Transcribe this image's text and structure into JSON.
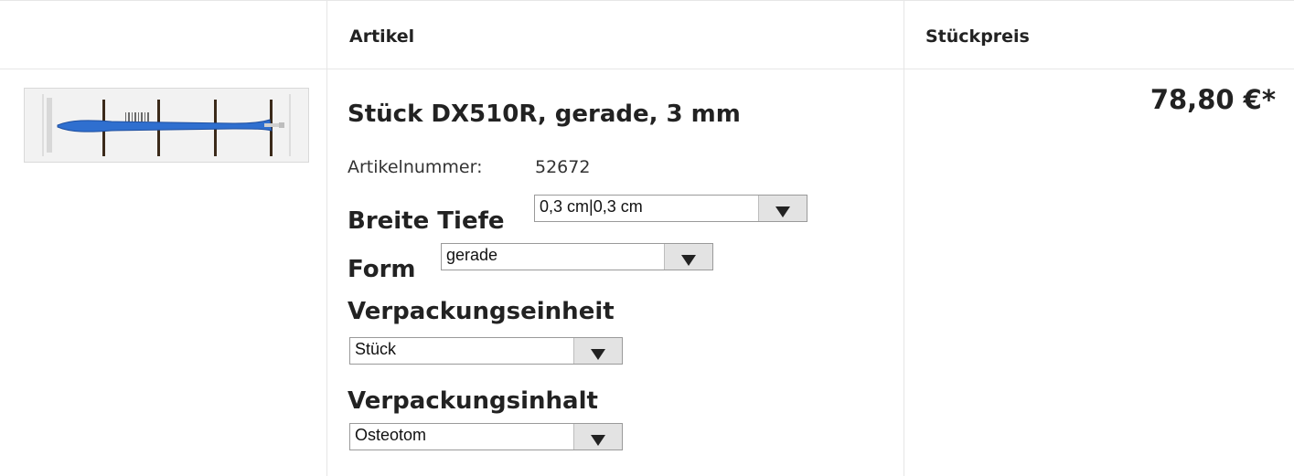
{
  "table": {
    "headers": {
      "article": "Artikel",
      "unit_price": "Stückpreis"
    }
  },
  "product": {
    "title": "Stück DX510R, gerade, 3 mm",
    "article_number_label": "Artikelnummer:",
    "article_number": "52672",
    "price": "78,80 €*",
    "image_icon": "blue-osteotome-in-sterile-package",
    "options": [
      {
        "label": "Breite Tiefe",
        "selected": "0,3 cm|0,3 cm"
      },
      {
        "label": "Form",
        "selected": "gerade"
      },
      {
        "label": "Verpackungseinheit",
        "selected": "Stück"
      },
      {
        "label": "Verpackungsinhalt",
        "selected": "Osteotom"
      }
    ]
  },
  "colors": {
    "text": "#222222",
    "grid": "#e6e6e6",
    "product_blue": "#2f6fcf"
  }
}
